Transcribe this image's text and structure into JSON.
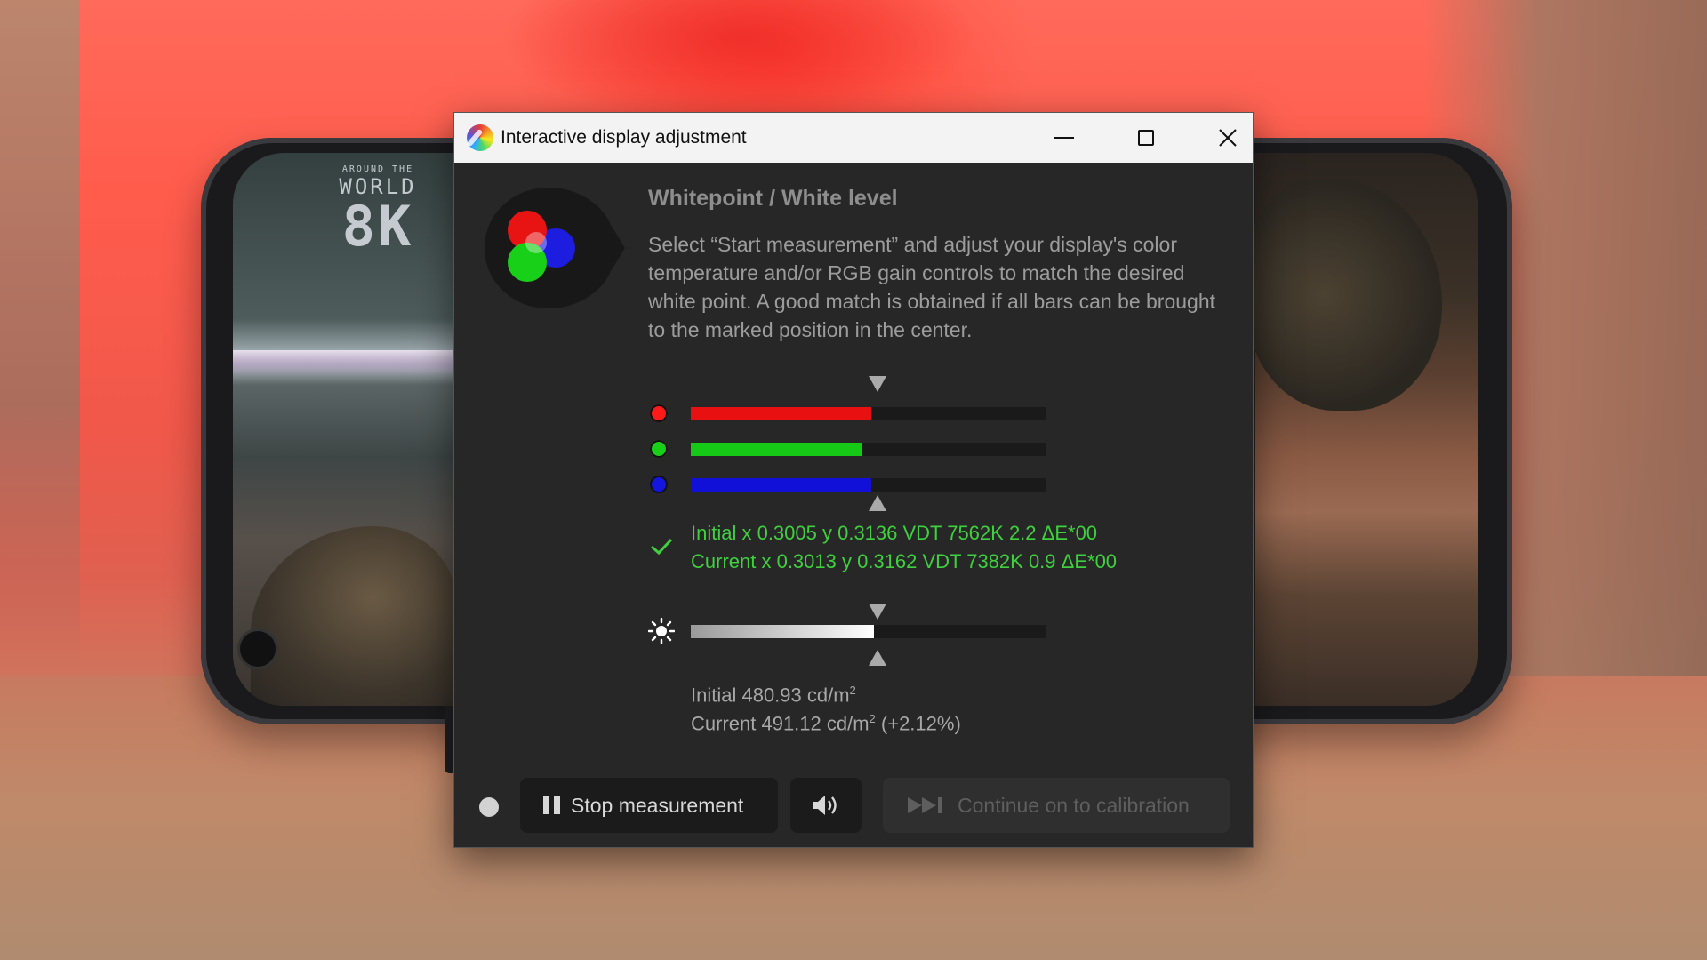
{
  "window": {
    "title": "Interactive display adjustment",
    "controls": {
      "minimize_icon": "minimize-icon",
      "maximize_icon": "maximize-icon",
      "close_icon": "close-icon"
    }
  },
  "panel": {
    "heading": "Whitepoint / White level",
    "description": "Select “Start measurement” and adjust your display's color temperature and/or RGB gain controls to match the desired white point. A good match is obtained if all bars can be brought to the marked position in the center."
  },
  "rgb_bars": [
    {
      "name": "red",
      "color": "#e81010",
      "dot_color": "#ff1a1a",
      "level": 0.508
    },
    {
      "name": "green",
      "color": "#16c916",
      "dot_color": "#19d019",
      "level": 0.48
    },
    {
      "name": "blue",
      "color": "#1010d8",
      "dot_color": "#1515e0",
      "level": 0.508
    }
  ],
  "whitepoint": {
    "initial": "Initial x 0.3005 y 0.3136 VDT 7562K 2.2 ΔE*00",
    "current": "Current x 0.3013 y 0.3162 VDT 7382K 0.9 ΔE*00",
    "status_icon": "checkmark-icon",
    "status_color": "#3fcf3f"
  },
  "luminance": {
    "icon": "brightness-icon",
    "level": 0.515,
    "initial_prefix": "Initial 480.93 cd/m",
    "current_prefix": "Current 491.12 cd/m",
    "current_suffix": " (+2.12%)",
    "unit_superscript": "2"
  },
  "actions": {
    "stop_label": "Stop measurement",
    "continue_label": "Continue on to calibration",
    "sound_icon": "speaker-icon"
  },
  "background_logo": {
    "top": "AROUND THE",
    "middle": "WORLD",
    "bottom": "8K"
  }
}
